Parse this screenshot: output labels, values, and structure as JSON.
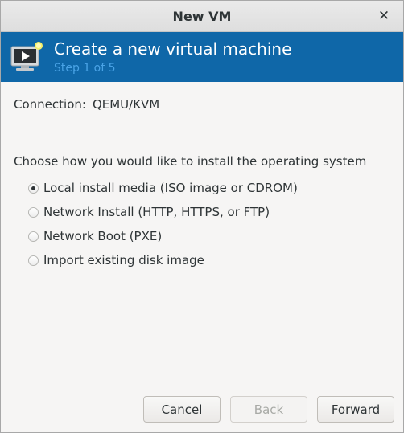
{
  "window": {
    "title": "New VM",
    "close_glyph": "✕"
  },
  "banner": {
    "title": "Create a new virtual machine",
    "step": "Step 1 of 5",
    "icon": "vm-monitor-icon",
    "background_color": "#0f67a8",
    "step_color": "#4aa3e6"
  },
  "connection": {
    "label": "Connection:",
    "value": "QEMU/KVM"
  },
  "install": {
    "prompt": "Choose how you would like to install the operating system",
    "options": [
      {
        "label": "Local install media (ISO image or CDROM)",
        "selected": true
      },
      {
        "label": "Network Install (HTTP, HTTPS, or FTP)",
        "selected": false
      },
      {
        "label": "Network Boot (PXE)",
        "selected": false
      },
      {
        "label": "Import existing disk image",
        "selected": false
      }
    ]
  },
  "buttons": {
    "cancel": "Cancel",
    "back": "Back",
    "forward": "Forward",
    "back_enabled": false
  }
}
